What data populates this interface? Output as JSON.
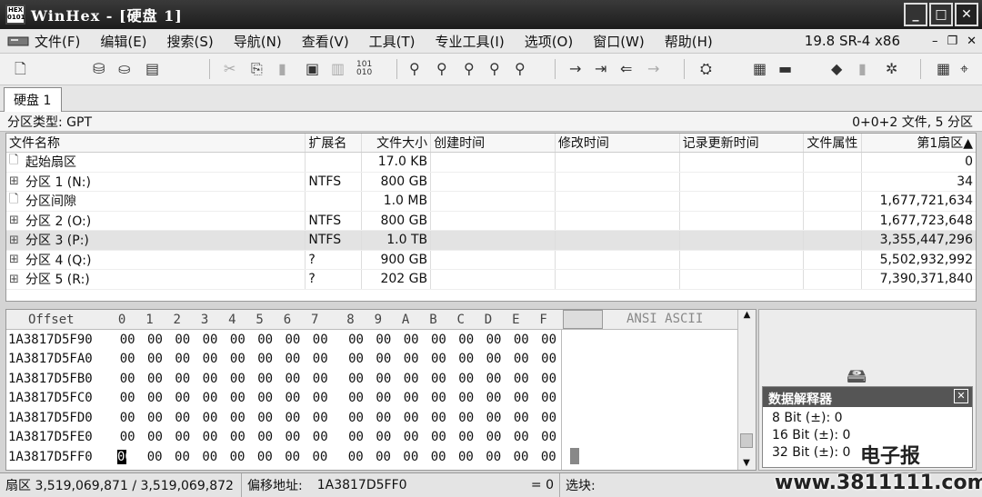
{
  "window": {
    "title": "WinHex - [硬盘 1]"
  },
  "menu": {
    "items": [
      "文件(F)",
      "编辑(E)",
      "搜索(S)",
      "导航(N)",
      "查看(V)",
      "工具(T)",
      "专业工具(I)",
      "选项(O)",
      "窗口(W)",
      "帮助(H)"
    ],
    "version": "19.8 SR-4 x86"
  },
  "tabs": [
    {
      "label": "硬盘 1"
    }
  ],
  "partition": {
    "type_label": "分区类型: GPT",
    "count_label": "0+0+2 文件, 5 分区"
  },
  "file_table": {
    "headers": [
      "文件名称",
      "扩展名",
      "文件大小",
      "创建时间",
      "修改时间",
      "记录更新时间",
      "文件属性",
      "第1扇区▲"
    ],
    "rows": [
      {
        "icon": "file-icon",
        "name": "起始扇区",
        "ext": "",
        "size": "17.0 KB",
        "sector": "0"
      },
      {
        "icon": "partition-icon",
        "name": "分区 1 (N:)",
        "ext": "NTFS",
        "size": "800 GB",
        "sector": "34"
      },
      {
        "icon": "file-icon",
        "name": "分区间隙",
        "ext": "",
        "size": "1.0 MB",
        "sector": "1,677,721,634"
      },
      {
        "icon": "partition-icon",
        "name": "分区 2 (O:)",
        "ext": "NTFS",
        "size": "800 GB",
        "sector": "1,677,723,648"
      },
      {
        "icon": "partition-icon",
        "name": "分区 3 (P:)",
        "ext": "NTFS",
        "size": "1.0 TB",
        "sector": "3,355,447,296"
      },
      {
        "icon": "partition-icon",
        "name": "分区 4 (Q:)",
        "ext": "?",
        "size": "900 GB",
        "sector": "5,502,932,992"
      },
      {
        "icon": "partition-icon",
        "name": "分区 5 (R:)",
        "ext": "?",
        "size": "202 GB",
        "sector": "7,390,371,840"
      }
    ]
  },
  "hex": {
    "offset_label": "Offset",
    "columns": [
      "0",
      "1",
      "2",
      "3",
      "4",
      "5",
      "6",
      "7",
      "8",
      "9",
      "A",
      "B",
      "C",
      "D",
      "E",
      "F"
    ],
    "ansi_label": "ANSI ASCII",
    "rows": [
      {
        "offset": "1A3817D5F90",
        "bytes": [
          "00",
          "00",
          "00",
          "00",
          "00",
          "00",
          "00",
          "00",
          "00",
          "00",
          "00",
          "00",
          "00",
          "00",
          "00",
          "00"
        ]
      },
      {
        "offset": "1A3817D5FA0",
        "bytes": [
          "00",
          "00",
          "00",
          "00",
          "00",
          "00",
          "00",
          "00",
          "00",
          "00",
          "00",
          "00",
          "00",
          "00",
          "00",
          "00"
        ]
      },
      {
        "offset": "1A3817D5FB0",
        "bytes": [
          "00",
          "00",
          "00",
          "00",
          "00",
          "00",
          "00",
          "00",
          "00",
          "00",
          "00",
          "00",
          "00",
          "00",
          "00",
          "00"
        ]
      },
      {
        "offset": "1A3817D5FC0",
        "bytes": [
          "00",
          "00",
          "00",
          "00",
          "00",
          "00",
          "00",
          "00",
          "00",
          "00",
          "00",
          "00",
          "00",
          "00",
          "00",
          "00"
        ]
      },
      {
        "offset": "1A3817D5FD0",
        "bytes": [
          "00",
          "00",
          "00",
          "00",
          "00",
          "00",
          "00",
          "00",
          "00",
          "00",
          "00",
          "00",
          "00",
          "00",
          "00",
          "00"
        ]
      },
      {
        "offset": "1A3817D5FE0",
        "bytes": [
          "00",
          "00",
          "00",
          "00",
          "00",
          "00",
          "00",
          "00",
          "00",
          "00",
          "00",
          "00",
          "00",
          "00",
          "00",
          "00"
        ]
      },
      {
        "offset": "1A3817D5FF0",
        "bytes": [
          "00",
          "00",
          "00",
          "00",
          "00",
          "00",
          "00",
          "00",
          "00",
          "00",
          "00",
          "00",
          "00",
          "00",
          "00",
          "00"
        ]
      }
    ]
  },
  "interpreter": {
    "title": "数据解释器",
    "rows": [
      "8 Bit (±): 0",
      "16 Bit (±): 0",
      "32 Bit (±): 0"
    ]
  },
  "status": {
    "sector": "扇区 3,519,069,871 / 3,519,069,872",
    "offset_label": "偏移地址:",
    "offset_value": "1A3817D5FF0",
    "value": "= 0",
    "selection": "选块:"
  },
  "watermark": {
    "brand": "电子报",
    "url": "www.3811111.com"
  }
}
